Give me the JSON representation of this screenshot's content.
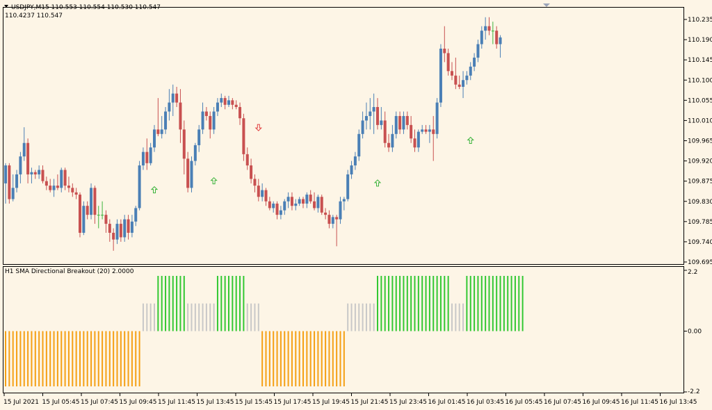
{
  "colors": {
    "background": "#fdf5e6",
    "frame": "#000000",
    "bull": "#4a7fb5",
    "bear": "#c85050",
    "doji": "#3cb43c",
    "arrow_up": "#3cb43c",
    "arrow_down": "#e04040",
    "hist_green": "#32c832",
    "hist_gray": "#c8c8c8",
    "hist_orange": "#f5a014"
  },
  "header": {
    "symbol_line": "USDJPY,M15  110.553 110.554 110.530 110.547",
    "info_line": "110.4237    110.547",
    "menu_icon": "triangle-down-icon"
  },
  "indicator": {
    "title": "H1 SMA Directional Breakout (20) 2.0000"
  },
  "time_axis": {
    "labels": [
      "15 Jul 2021",
      "15 Jul 05:45",
      "15 Jul 07:45",
      "15 Jul 09:45",
      "15 Jul 11:45",
      "15 Jul 13:45",
      "15 Jul 15:45",
      "15 Jul 17:45",
      "15 Jul 19:45",
      "15 Jul 21:45",
      "15 Jul 23:45",
      "16 Jul 01:45",
      "16 Jul 03:45",
      "16 Jul 05:45",
      "16 Jul 07:45",
      "16 Jul 09:45",
      "16 Jul 11:45",
      "16 Jul 13:45"
    ]
  },
  "chart_data": [
    {
      "type": "candlestick",
      "title": "USDJPY,M15",
      "ylim": [
        109.695,
        110.255
      ],
      "price_ticks": [
        "110.235",
        "110.190",
        "110.145",
        "110.100",
        "110.055",
        "110.010",
        "109.965",
        "109.920",
        "109.875",
        "109.830",
        "109.785",
        "109.740",
        "109.695"
      ],
      "candles": [
        {
          "o": 109.87,
          "h": 109.915,
          "l": 109.825,
          "c": 109.91
        },
        {
          "o": 109.91,
          "h": 109.915,
          "l": 109.825,
          "c": 109.835
        },
        {
          "o": 109.835,
          "h": 109.89,
          "l": 109.83,
          "c": 109.86
        },
        {
          "o": 109.86,
          "h": 109.9,
          "l": 109.85,
          "c": 109.89
        },
        {
          "o": 109.89,
          "h": 109.94,
          "l": 109.87,
          "c": 109.93
        },
        {
          "o": 109.93,
          "h": 109.995,
          "l": 109.92,
          "c": 109.96
        },
        {
          "o": 109.96,
          "h": 109.97,
          "l": 109.87,
          "c": 109.89
        },
        {
          "o": 109.89,
          "h": 109.905,
          "l": 109.87,
          "c": 109.895
        },
        {
          "o": 109.895,
          "h": 109.9,
          "l": 109.88,
          "c": 109.89
        },
        {
          "o": 109.89,
          "h": 109.91,
          "l": 109.88,
          "c": 109.9
        },
        {
          "o": 109.9,
          "h": 109.91,
          "l": 109.87,
          "c": 109.875
        },
        {
          "o": 109.875,
          "h": 109.885,
          "l": 109.855,
          "c": 109.865
        },
        {
          "o": 109.865,
          "h": 109.88,
          "l": 109.85,
          "c": 109.855
        },
        {
          "o": 109.855,
          "h": 109.88,
          "l": 109.84,
          "c": 109.865
        },
        {
          "o": 109.865,
          "h": 109.89,
          "l": 109.855,
          "c": 109.86
        },
        {
          "o": 109.86,
          "h": 109.905,
          "l": 109.85,
          "c": 109.9
        },
        {
          "o": 109.9,
          "h": 109.905,
          "l": 109.855,
          "c": 109.865
        },
        {
          "o": 109.865,
          "h": 109.885,
          "l": 109.85,
          "c": 109.86
        },
        {
          "o": 109.86,
          "h": 109.87,
          "l": 109.84,
          "c": 109.85
        },
        {
          "o": 109.85,
          "h": 109.86,
          "l": 109.835,
          "c": 109.845
        },
        {
          "o": 109.845,
          "h": 109.85,
          "l": 109.75,
          "c": 109.76
        },
        {
          "o": 109.76,
          "h": 109.83,
          "l": 109.755,
          "c": 109.82
        },
        {
          "o": 109.82,
          "h": 109.83,
          "l": 109.79,
          "c": 109.8
        },
        {
          "o": 109.8,
          "h": 109.87,
          "l": 109.79,
          "c": 109.86
        },
        {
          "o": 109.86,
          "h": 109.865,
          "l": 109.78,
          "c": 109.8
        },
        {
          "o": 109.8,
          "h": 109.82,
          "l": 109.77,
          "c": 109.8
        },
        {
          "o": 109.8,
          "h": 109.83,
          "l": 109.79,
          "c": 109.8
        },
        {
          "o": 109.8,
          "h": 109.81,
          "l": 109.76,
          "c": 109.78
        },
        {
          "o": 109.78,
          "h": 109.79,
          "l": 109.74,
          "c": 109.76
        },
        {
          "o": 109.76,
          "h": 109.77,
          "l": 109.72,
          "c": 109.745
        },
        {
          "o": 109.745,
          "h": 109.79,
          "l": 109.735,
          "c": 109.78
        },
        {
          "o": 109.78,
          "h": 109.79,
          "l": 109.74,
          "c": 109.75
        },
        {
          "o": 109.75,
          "h": 109.8,
          "l": 109.74,
          "c": 109.79
        },
        {
          "o": 109.79,
          "h": 109.8,
          "l": 109.745,
          "c": 109.76
        },
        {
          "o": 109.76,
          "h": 109.8,
          "l": 109.75,
          "c": 109.785
        },
        {
          "o": 109.785,
          "h": 109.82,
          "l": 109.775,
          "c": 109.815
        },
        {
          "o": 109.815,
          "h": 109.92,
          "l": 109.81,
          "c": 109.91
        },
        {
          "o": 109.91,
          "h": 109.95,
          "l": 109.9,
          "c": 109.94
        },
        {
          "o": 109.94,
          "h": 109.97,
          "l": 109.9,
          "c": 109.915
        },
        {
          "o": 109.915,
          "h": 109.96,
          "l": 109.91,
          "c": 109.95
        },
        {
          "o": 109.95,
          "h": 110.0,
          "l": 109.94,
          "c": 109.99
        },
        {
          "o": 109.99,
          "h": 110.06,
          "l": 109.975,
          "c": 109.98
        },
        {
          "o": 109.98,
          "h": 110.02,
          "l": 109.97,
          "c": 109.99
        },
        {
          "o": 109.99,
          "h": 110.04,
          "l": 109.98,
          "c": 110.03
        },
        {
          "o": 110.03,
          "h": 110.08,
          "l": 110.01,
          "c": 110.05
        },
        {
          "o": 110.05,
          "h": 110.09,
          "l": 110.02,
          "c": 110.07
        },
        {
          "o": 110.07,
          "h": 110.085,
          "l": 110.04,
          "c": 110.05
        },
        {
          "o": 110.05,
          "h": 110.08,
          "l": 109.96,
          "c": 109.99
        },
        {
          "o": 109.99,
          "h": 110.01,
          "l": 109.89,
          "c": 109.925
        },
        {
          "o": 109.925,
          "h": 109.94,
          "l": 109.85,
          "c": 109.86
        },
        {
          "o": 109.86,
          "h": 109.93,
          "l": 109.85,
          "c": 109.92
        },
        {
          "o": 109.92,
          "h": 109.96,
          "l": 109.91,
          "c": 109.955
        },
        {
          "o": 109.955,
          "h": 110.0,
          "l": 109.94,
          "c": 109.99
        },
        {
          "o": 109.99,
          "h": 110.05,
          "l": 109.98,
          "c": 110.03
        },
        {
          "o": 110.03,
          "h": 110.04,
          "l": 110.01,
          "c": 110.02
        },
        {
          "o": 110.02,
          "h": 110.03,
          "l": 109.97,
          "c": 109.99
        },
        {
          "o": 109.99,
          "h": 110.04,
          "l": 109.98,
          "c": 110.03
        },
        {
          "o": 110.03,
          "h": 110.06,
          "l": 110.02,
          "c": 110.05
        },
        {
          "o": 110.05,
          "h": 110.07,
          "l": 110.04,
          "c": 110.06
        },
        {
          "o": 110.06,
          "h": 110.065,
          "l": 110.035,
          "c": 110.045
        },
        {
          "o": 110.045,
          "h": 110.065,
          "l": 110.04,
          "c": 110.055
        },
        {
          "o": 110.055,
          "h": 110.06,
          "l": 110.035,
          "c": 110.045
        },
        {
          "o": 110.045,
          "h": 110.055,
          "l": 110.035,
          "c": 110.04
        },
        {
          "o": 110.04,
          "h": 110.05,
          "l": 110.0,
          "c": 110.015
        },
        {
          "o": 110.015,
          "h": 110.025,
          "l": 109.92,
          "c": 109.935
        },
        {
          "o": 109.935,
          "h": 109.95,
          "l": 109.9,
          "c": 109.91
        },
        {
          "o": 109.91,
          "h": 109.925,
          "l": 109.87,
          "c": 109.88
        },
        {
          "o": 109.88,
          "h": 109.89,
          "l": 109.85,
          "c": 109.865
        },
        {
          "o": 109.865,
          "h": 109.88,
          "l": 109.83,
          "c": 109.84
        },
        {
          "o": 109.84,
          "h": 109.87,
          "l": 109.83,
          "c": 109.855
        },
        {
          "o": 109.855,
          "h": 109.86,
          "l": 109.82,
          "c": 109.83
        },
        {
          "o": 109.83,
          "h": 109.84,
          "l": 109.81,
          "c": 109.815
        },
        {
          "o": 109.815,
          "h": 109.83,
          "l": 109.805,
          "c": 109.825
        },
        {
          "o": 109.825,
          "h": 109.83,
          "l": 109.79,
          "c": 109.8
        },
        {
          "o": 109.8,
          "h": 109.82,
          "l": 109.79,
          "c": 109.81
        },
        {
          "o": 109.81,
          "h": 109.835,
          "l": 109.8,
          "c": 109.83
        },
        {
          "o": 109.83,
          "h": 109.85,
          "l": 109.815,
          "c": 109.84
        },
        {
          "o": 109.84,
          "h": 109.85,
          "l": 109.81,
          "c": 109.82
        },
        {
          "o": 109.82,
          "h": 109.835,
          "l": 109.81,
          "c": 109.825
        },
        {
          "o": 109.825,
          "h": 109.84,
          "l": 109.82,
          "c": 109.835
        },
        {
          "o": 109.835,
          "h": 109.84,
          "l": 109.815,
          "c": 109.825
        },
        {
          "o": 109.825,
          "h": 109.85,
          "l": 109.815,
          "c": 109.845
        },
        {
          "o": 109.845,
          "h": 109.855,
          "l": 109.825,
          "c": 109.83
        },
        {
          "o": 109.83,
          "h": 109.85,
          "l": 109.81,
          "c": 109.815
        },
        {
          "o": 109.815,
          "h": 109.845,
          "l": 109.805,
          "c": 109.84
        },
        {
          "o": 109.84,
          "h": 109.845,
          "l": 109.8,
          "c": 109.805
        },
        {
          "o": 109.805,
          "h": 109.815,
          "l": 109.79,
          "c": 109.8
        },
        {
          "o": 109.8,
          "h": 109.81,
          "l": 109.77,
          "c": 109.78
        },
        {
          "o": 109.78,
          "h": 109.8,
          "l": 109.77,
          "c": 109.795
        },
        {
          "o": 109.795,
          "h": 109.8,
          "l": 109.73,
          "c": 109.79
        },
        {
          "o": 109.79,
          "h": 109.84,
          "l": 109.78,
          "c": 109.83
        },
        {
          "o": 109.83,
          "h": 109.84,
          "l": 109.81,
          "c": 109.835
        },
        {
          "o": 109.835,
          "h": 109.9,
          "l": 109.83,
          "c": 109.89
        },
        {
          "o": 109.89,
          "h": 109.92,
          "l": 109.88,
          "c": 109.91
        },
        {
          "o": 109.91,
          "h": 109.94,
          "l": 109.9,
          "c": 109.93
        },
        {
          "o": 109.93,
          "h": 109.99,
          "l": 109.92,
          "c": 109.98
        },
        {
          "o": 109.98,
          "h": 110.03,
          "l": 109.97,
          "c": 110.01
        },
        {
          "o": 110.01,
          "h": 110.05,
          "l": 109.99,
          "c": 110.02
        },
        {
          "o": 110.02,
          "h": 110.06,
          "l": 109.99,
          "c": 110.03
        },
        {
          "o": 110.03,
          "h": 110.07,
          "l": 109.98,
          "c": 110.04
        },
        {
          "o": 110.04,
          "h": 110.06,
          "l": 109.99,
          "c": 110.0
        },
        {
          "o": 110.0,
          "h": 110.04,
          "l": 109.99,
          "c": 110.01
        },
        {
          "o": 110.01,
          "h": 110.03,
          "l": 109.95,
          "c": 109.96
        },
        {
          "o": 109.96,
          "h": 109.98,
          "l": 109.94,
          "c": 109.95
        },
        {
          "o": 109.95,
          "h": 110.0,
          "l": 109.94,
          "c": 109.98
        },
        {
          "o": 109.98,
          "h": 110.03,
          "l": 109.97,
          "c": 110.02
        },
        {
          "o": 110.02,
          "h": 110.03,
          "l": 109.98,
          "c": 109.99
        },
        {
          "o": 109.99,
          "h": 110.03,
          "l": 109.98,
          "c": 110.02
        },
        {
          "o": 110.02,
          "h": 110.03,
          "l": 109.99,
          "c": 110.0
        },
        {
          "o": 110.0,
          "h": 110.02,
          "l": 109.96,
          "c": 109.97
        },
        {
          "o": 109.97,
          "h": 109.99,
          "l": 109.94,
          "c": 109.95
        },
        {
          "o": 109.95,
          "h": 109.99,
          "l": 109.94,
          "c": 109.985
        },
        {
          "o": 109.985,
          "h": 110.0,
          "l": 109.98,
          "c": 109.99
        },
        {
          "o": 109.99,
          "h": 110.0,
          "l": 109.98,
          "c": 109.985
        },
        {
          "o": 109.985,
          "h": 110.0,
          "l": 109.96,
          "c": 109.99
        },
        {
          "o": 109.99,
          "h": 110.02,
          "l": 109.92,
          "c": 109.98
        },
        {
          "o": 109.98,
          "h": 110.06,
          "l": 109.97,
          "c": 110.05
        },
        {
          "o": 110.05,
          "h": 110.18,
          "l": 110.04,
          "c": 110.17
        },
        {
          "o": 110.17,
          "h": 110.22,
          "l": 110.14,
          "c": 110.16
        },
        {
          "o": 110.16,
          "h": 110.17,
          "l": 110.11,
          "c": 110.12
        },
        {
          "o": 110.12,
          "h": 110.14,
          "l": 110.1,
          "c": 110.11
        },
        {
          "o": 110.11,
          "h": 110.15,
          "l": 110.08,
          "c": 110.09
        },
        {
          "o": 110.09,
          "h": 110.11,
          "l": 110.08,
          "c": 110.085
        },
        {
          "o": 110.085,
          "h": 110.12,
          "l": 110.06,
          "c": 110.1
        },
        {
          "o": 110.1,
          "h": 110.12,
          "l": 110.09,
          "c": 110.11
        },
        {
          "o": 110.11,
          "h": 110.14,
          "l": 110.1,
          "c": 110.13
        },
        {
          "o": 110.13,
          "h": 110.16,
          "l": 110.12,
          "c": 110.15
        },
        {
          "o": 110.15,
          "h": 110.19,
          "l": 110.14,
          "c": 110.18
        },
        {
          "o": 110.18,
          "h": 110.22,
          "l": 110.17,
          "c": 110.21
        },
        {
          "o": 110.21,
          "h": 110.24,
          "l": 110.19,
          "c": 110.22
        },
        {
          "o": 110.22,
          "h": 110.24,
          "l": 110.2,
          "c": 110.21
        },
        {
          "o": 110.21,
          "h": 110.23,
          "l": 110.18,
          "c": 110.21
        },
        {
          "o": 110.21,
          "h": 110.22,
          "l": 110.17,
          "c": 110.18
        },
        {
          "o": 110.18,
          "h": 110.2,
          "l": 110.15,
          "c": 110.195
        }
      ],
      "arrows": [
        {
          "bar": 40,
          "price": 109.855,
          "dir": "up"
        },
        {
          "bar": 56,
          "price": 109.875,
          "dir": "up"
        },
        {
          "bar": 68,
          "price": 109.995,
          "dir": "down"
        },
        {
          "bar": 100,
          "price": 109.87,
          "dir": "up"
        },
        {
          "bar": 125,
          "price": 109.965,
          "dir": "up"
        }
      ]
    },
    {
      "type": "histogram",
      "title": "H1 SMA Directional Breakout (20) 2.0000",
      "ylim": [
        -2.2,
        2.2
      ],
      "y_ticks": [
        "2.2",
        "0.00",
        "-2.2"
      ],
      "segments": [
        {
          "count": 37,
          "value": -2,
          "color": "orange"
        },
        {
          "count": 4,
          "value": 1,
          "color": "gray"
        },
        {
          "count": 8,
          "value": 2,
          "color": "green"
        },
        {
          "count": 8,
          "value": 1,
          "color": "gray"
        },
        {
          "count": 8,
          "value": 2,
          "color": "green"
        },
        {
          "count": 4,
          "value": 1,
          "color": "gray"
        },
        {
          "count": 23,
          "value": -2,
          "color": "orange"
        },
        {
          "count": 8,
          "value": 1,
          "color": "gray"
        },
        {
          "count": 20,
          "value": 2,
          "color": "green"
        },
        {
          "count": 4,
          "value": 1,
          "color": "gray"
        },
        {
          "count": 16,
          "value": 2,
          "color": "green"
        }
      ]
    }
  ]
}
